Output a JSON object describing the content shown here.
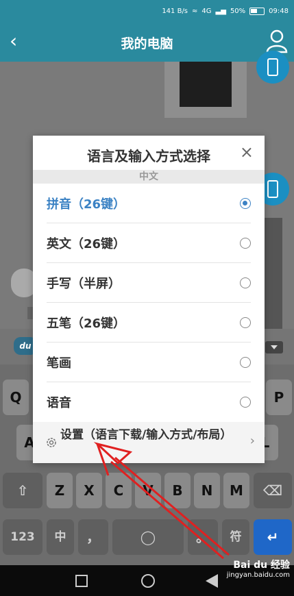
{
  "status": {
    "speed": "141 B/s",
    "network": "4G",
    "battery": "50%",
    "time": "09:48"
  },
  "header": {
    "title": "我的电脑"
  },
  "dialog": {
    "title": "语言及输入方式选择",
    "close": "×",
    "section": "中文",
    "options": [
      {
        "label": "拼音（26键）",
        "selected": true
      },
      {
        "label": "英文（26键）",
        "selected": false
      },
      {
        "label": "手写（半屏）",
        "selected": false
      },
      {
        "label": "五笔（26键）",
        "selected": false
      },
      {
        "label": "笔画",
        "selected": false
      },
      {
        "label": "语音",
        "selected": false
      }
    ],
    "settings": "设置（语言下载/输入方式/布局）",
    "chevron": "›"
  },
  "keyboard": {
    "logo": "du",
    "row1": [
      "Q",
      "P"
    ],
    "row2": [
      "A",
      "L"
    ],
    "row3": [
      "Z",
      "X",
      "C",
      "V",
      "B",
      "N",
      "M"
    ],
    "row4": {
      "num": "123",
      "zh": "中",
      "comma": "，",
      "period": "。",
      "sym": "符"
    }
  },
  "watermark": {
    "brand": "Bai du 经验",
    "url": "jingyan.baidu.com"
  },
  "colors": {
    "accent": "#3b82c4",
    "titlebar": "#2a8a9e",
    "annotation": "#e02020"
  }
}
